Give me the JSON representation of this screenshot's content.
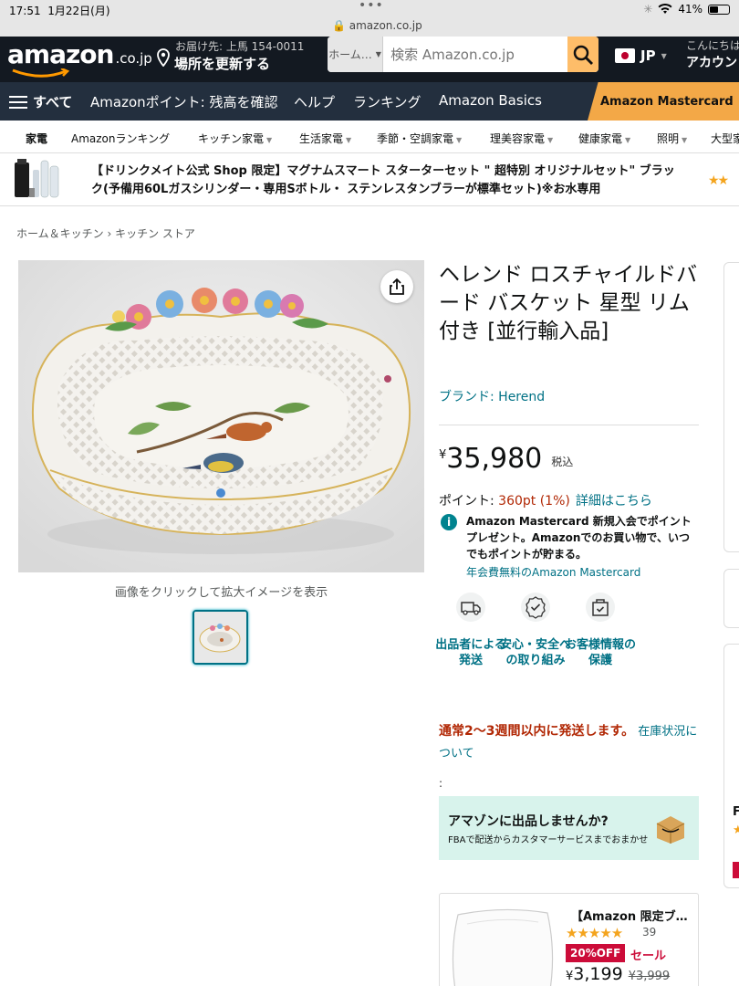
{
  "status_bar": {
    "time": "17:51",
    "date": "1月22日(月)",
    "dots": "•••",
    "url": "amazon.co.jp",
    "battery": "41%"
  },
  "header": {
    "logo": "amazon",
    "logo_suffix": ".co.jp",
    "deliver_to": "お届け先: 上馬 154-0011",
    "update_location": "場所を更新する",
    "search_category": "ホーム…",
    "search_placeholder": "検索 Amazon.co.jp",
    "lang": "JP",
    "greeting": "こんにちは",
    "account": "アカウント"
  },
  "nav": {
    "all": "すべて",
    "links": [
      "Amazonポイント: 残高を確認",
      "ヘルプ",
      "ランキング",
      "Amazon Basics"
    ],
    "promo": "Amazon Mastercard"
  },
  "subnav": {
    "items": [
      "家電",
      "Amazonランキング",
      "キッチン家電",
      "生活家電",
      "季節・空調家電",
      "理美容家電",
      "健康家電",
      "照明",
      "大型家"
    ]
  },
  "banner": {
    "text": "【ドリンクメイト公式 Shop 限定】マグナムスマート スターターセット \" 超特別 オリジナルセット\" ブラック(予備用60Lガスシリンダー・専用Sボトル・ ステンレスタンブラーが標準セット)※お水専用",
    "stars": "★★"
  },
  "breadcrumb": "ホーム＆キッチン › キッチン ストア",
  "image_caption": "画像をクリックして拡大イメージを表示",
  "product": {
    "title": "ヘレンド ロスチャイルドバード バスケット 星型 リム付き [並行輸入品]",
    "brand": "ブランド: Herend",
    "currency": "¥",
    "price": "35,980",
    "tax": "税込",
    "points_label": "ポイント: ",
    "points_value": "360pt  (1%)",
    "points_link": "詳細はこちら",
    "mc_text": "Amazon Mastercard 新規入会でポイントプレゼント。Amazonでのお買い物で、いつでもポイントが貯まる。",
    "mc_link": "年会費無料のAmazon Mastercard",
    "features": [
      {
        "label": "出品者による発送",
        "icon": "truck-icon"
      },
      {
        "label": "安心・安全への取り組み",
        "icon": "badge-icon"
      },
      {
        "label": "お客様情報の保護",
        "icon": "shield-bag-icon"
      }
    ],
    "shipping_red": "通常2〜3週間以内に発送します。",
    "shipping_link": " 在庫状況について",
    "colon": ":"
  },
  "sell_box": {
    "title": "アマゾンに出品しませんか?",
    "subtitle": "FBAで配送からカスタマーサービスまでおまかせ"
  },
  "ad": {
    "title": "【Amazon 限定ブ…",
    "stars": "★★★★★",
    "count": "39",
    "badge": "20%OFF",
    "sale": "セール",
    "currency": "¥",
    "price": "3,199",
    "old_price": "¥3,999"
  },
  "right_cards": {
    "letter": "F",
    "star": "★"
  },
  "colors": {
    "header_bg": "#131921",
    "nav_bg": "#232f3e",
    "search_button": "#febd69",
    "link": "#007185",
    "price_red": "#b12704",
    "sale_red": "#cc0c39",
    "promo": "#f3a847"
  }
}
